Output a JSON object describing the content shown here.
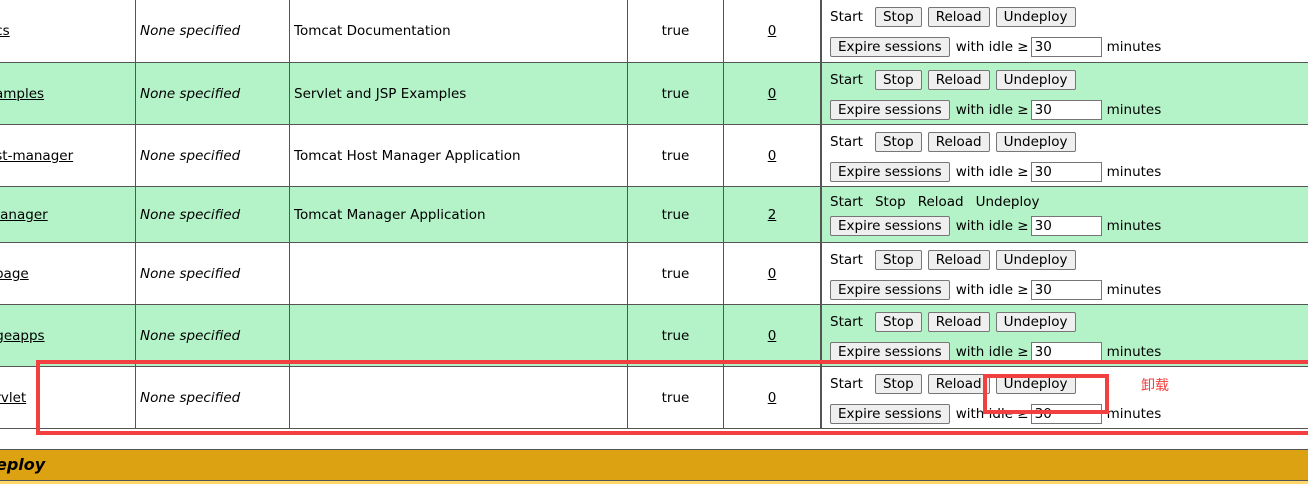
{
  "commands": {
    "start": "Start",
    "stop": "Stop",
    "reload": "Reload",
    "undeploy": "Undeploy",
    "expire": "Expire sessions",
    "with_idle": "with idle ≥",
    "minutes": "minutes"
  },
  "apps": [
    {
      "path": "ocs",
      "version": "None specified",
      "name": "Tomcat Documentation",
      "running": "true",
      "sessions": "0",
      "idle": "30",
      "style": "white",
      "buttons": true
    },
    {
      "path": "xamples",
      "version": "None specified",
      "name": "Servlet and JSP Examples",
      "running": "true",
      "sessions": "0",
      "idle": "30",
      "style": "green",
      "buttons": true
    },
    {
      "path": "ost-manager",
      "version": "None specified",
      "name": "Tomcat Host Manager Application",
      "running": "true",
      "sessions": "0",
      "idle": "30",
      "style": "white",
      "buttons": true
    },
    {
      "path": "manager",
      "version": "None specified",
      "name": "Tomcat Manager Application",
      "running": "true",
      "sessions": "2",
      "idle": "30",
      "style": "green",
      "buttons": false
    },
    {
      "path": "ypage",
      "version": "None specified",
      "name": "",
      "running": "true",
      "sessions": "0",
      "idle": "30",
      "style": "white",
      "buttons": true
    },
    {
      "path": "ageapps",
      "version": "None specified",
      "name": "",
      "running": "true",
      "sessions": "0",
      "idle": "30",
      "style": "green",
      "buttons": true
    },
    {
      "path": "ervlet",
      "version": "None specified",
      "name": "",
      "running": "true",
      "sessions": "0",
      "idle": "30",
      "style": "white",
      "buttons": true
    }
  ],
  "section_title": "eploy",
  "annotation": "卸载",
  "colors": {
    "green_row": "#b4f2c8",
    "section_bar": "#dca212",
    "highlight": "#f24040"
  }
}
